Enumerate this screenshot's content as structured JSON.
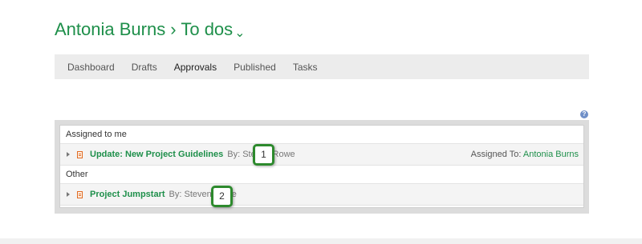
{
  "header": {
    "title": "Antonia Burns › To dos",
    "chevron": "⌄"
  },
  "nav": [
    "Dashboard",
    "Drafts",
    "Approvals",
    "Published",
    "Tasks"
  ],
  "nav_active": "Approvals",
  "help_icon": "?",
  "sections": {
    "assigned": {
      "label": "Assigned to me",
      "item": {
        "title": "Update: New Project Guidelines",
        "by": "By: Steven Rowe",
        "assigned_label": "Assigned To:",
        "assigned_name": "Antonia Burns",
        "badge": "1"
      }
    },
    "other": {
      "label": "Other",
      "item": {
        "title": "Project Jumpstart",
        "by": "By: Steven Rowe",
        "badge": "2"
      }
    }
  },
  "colors": {
    "accent": "#1e8f4a",
    "badge_border": "#2d8a2d",
    "doc_icon": "#e06a22"
  }
}
